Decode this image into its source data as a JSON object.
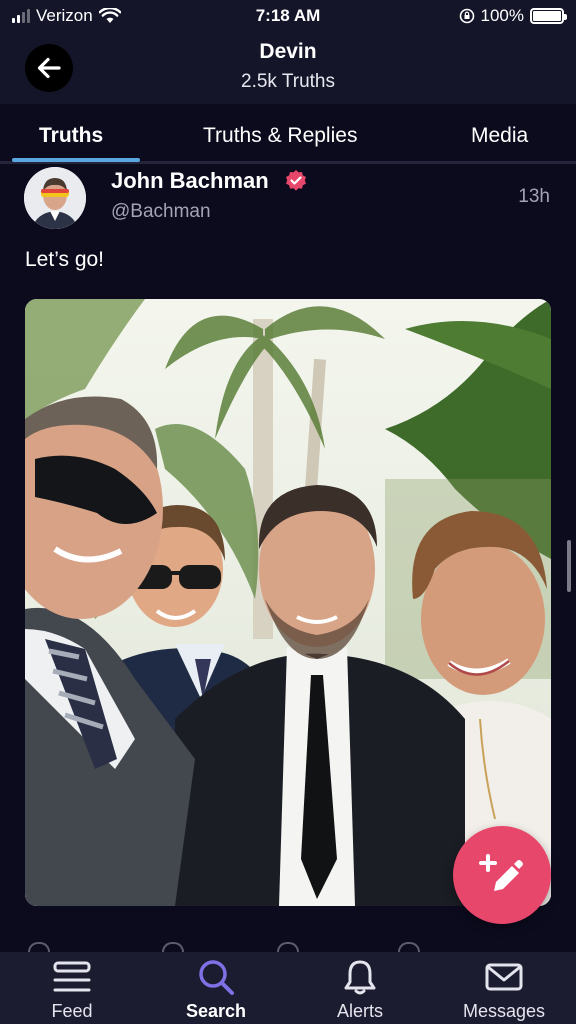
{
  "status_bar": {
    "carrier": "Verizon",
    "time": "7:18 AM",
    "battery": "100%"
  },
  "header": {
    "title": "Devin",
    "subtitle": "2.5k Truths"
  },
  "tabs": [
    {
      "label": "Truths",
      "active": true
    },
    {
      "label": "Truths & Replies",
      "active": false
    },
    {
      "label": "Media",
      "active": false
    }
  ],
  "post": {
    "author_name": "John Bachman",
    "handle": "@Bachman",
    "time": "13h",
    "text": "Let’s go!"
  },
  "bottom_nav": [
    {
      "label": "Feed",
      "icon": "feed-icon",
      "active": false
    },
    {
      "label": "Search",
      "icon": "search-icon",
      "active": true
    },
    {
      "label": "Alerts",
      "icon": "bell-icon",
      "active": false
    },
    {
      "label": "Messages",
      "icon": "mail-icon",
      "active": false
    }
  ],
  "colors": {
    "background": "#0c0b1e",
    "header": "#15152a",
    "tab_indicator": "#5aa6e0",
    "fab": "#e8476c",
    "active_nav_icon": "#7e71e6",
    "verified_badge": "#e8476c"
  }
}
